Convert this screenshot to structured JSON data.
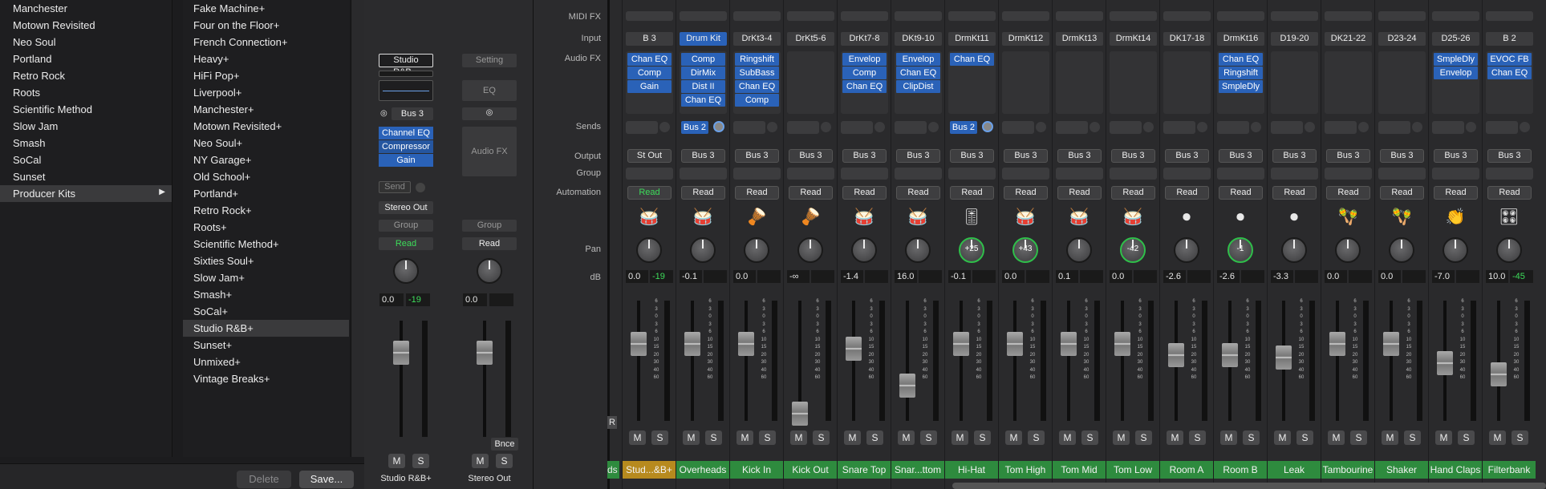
{
  "kits": [
    "Manchester",
    "Motown Revisited",
    "Neo Soul",
    "Portland",
    "Retro Rock",
    "Roots",
    "Scientific Method",
    "Slow Jam",
    "Smash",
    "SoCal",
    "Sunset",
    "Producer Kits"
  ],
  "patches": [
    "Fake Machine+",
    "Four on the Floor+",
    "French Connection+",
    "Heavy+",
    "HiFi Pop+",
    "Liverpool+",
    "Manchester+",
    "Motown Revisited+",
    "Neo Soul+",
    "NY Garage+",
    "Old School+",
    "Portland+",
    "Retro Rock+",
    "Roots+",
    "Scientific Method+",
    "Sixties Soul+",
    "Slow Jam+",
    "Smash+",
    "SoCal+",
    "Studio R&B+",
    "Sunset+",
    "Unmixed+",
    "Vintage Breaks+"
  ],
  "buttons": {
    "delete": "Delete",
    "save": "Save..."
  },
  "inspector": {
    "left": {
      "setting": "Studio R&B...",
      "input": "Bus 3",
      "plugins": [
        "Channel EQ",
        "Compressor",
        "Gain"
      ],
      "send": "Send",
      "output": "Stereo Out",
      "group": "Group",
      "automation": "Read",
      "db1": "0.0",
      "db2": "-19",
      "m": "M",
      "s": "S",
      "name": "Studio R&B+"
    },
    "right": {
      "setting": "Setting",
      "eq": "EQ",
      "audiofx": "Audio FX",
      "group": "Group",
      "automation": "Read",
      "db1": "0.0",
      "bnce": "Bnce",
      "m": "M",
      "s": "S",
      "name": "Stereo Out"
    }
  },
  "rowlabels": {
    "midifx": "MIDI FX",
    "input": "Input",
    "audiofx": "Audio FX",
    "sends": "Sends",
    "output": "Output",
    "group": "Group",
    "automation": "Automation",
    "pan": "Pan",
    "db": "dB"
  },
  "scale": [
    "6",
    "3",
    "0",
    "3",
    "6",
    "10",
    "15",
    "20",
    "30",
    "40",
    "60"
  ],
  "channels": [
    {
      "input": "B 3",
      "plugins": [
        "Chan EQ",
        "Comp",
        "Gain"
      ],
      "send": "",
      "output": "St Out",
      "auto": "Read",
      "pan": "",
      "db": "0.0",
      "peak": "-19",
      "name": "Stud...&B+",
      "icon": "🥁",
      "fader": 0.72,
      "color": "#b78a1e"
    },
    {
      "input": "Drum Kit",
      "plugins": [
        "Comp",
        "DirMix",
        "Dist II",
        "Chan EQ"
      ],
      "send": "Bus 2",
      "output": "Bus 3",
      "auto": "Read",
      "pan": "",
      "db": "-0.1",
      "peak": "",
      "name": "Overheads",
      "icon": "🥁",
      "fader": 0.72,
      "color": "#2e8b3e"
    },
    {
      "input": "DrKt3-4",
      "plugins": [
        "Ringshift",
        "SubBass",
        "Chan EQ",
        "Comp"
      ],
      "send": "",
      "output": "Bus 3",
      "auto": "Read",
      "pan": "",
      "db": "0.0",
      "peak": "",
      "name": "Kick In",
      "icon": "🪘",
      "fader": 0.72,
      "color": "#2e8b3e"
    },
    {
      "input": "DrKt5-6",
      "plugins": [],
      "send": "",
      "output": "Bus 3",
      "auto": "Read",
      "pan": "",
      "db": "-∞",
      "peak": "",
      "name": "Kick Out",
      "icon": "🪘",
      "fader": 0.1,
      "color": "#2e8b3e"
    },
    {
      "input": "DrKt7-8",
      "plugins": [
        "Envelop",
        "Comp",
        "Chan EQ"
      ],
      "send": "",
      "output": "Bus 3",
      "auto": "Read",
      "pan": "",
      "db": "-1.4",
      "peak": "",
      "name": "Snare Top",
      "icon": "🥁",
      "fader": 0.68,
      "color": "#2e8b3e"
    },
    {
      "input": "DKt9-10",
      "plugins": [
        "Envelop",
        "Chan EQ",
        "ClipDist"
      ],
      "send": "",
      "output": "Bus 3",
      "auto": "Read",
      "pan": "",
      "db": "16.0",
      "peak": "",
      "name": "Snar...ttom",
      "icon": "🥁",
      "fader": 0.35,
      "color": "#2e8b3e"
    },
    {
      "input": "DrmKt11",
      "plugins": [
        "Chan EQ"
      ],
      "send": "Bus 2",
      "output": "Bus 3",
      "auto": "Read",
      "pan": "+25",
      "db": "-0.1",
      "peak": "",
      "name": "Hi-Hat",
      "icon": "🎚",
      "fader": 0.72,
      "color": "#2e8b3e"
    },
    {
      "input": "DrmKt12",
      "plugins": [],
      "send": "",
      "output": "Bus 3",
      "auto": "Read",
      "pan": "+43",
      "db": "0.0",
      "peak": "",
      "name": "Tom High",
      "icon": "🥁",
      "fader": 0.72,
      "color": "#2e8b3e"
    },
    {
      "input": "DrmKt13",
      "plugins": [],
      "send": "",
      "output": "Bus 3",
      "auto": "Read",
      "pan": "",
      "db": "0.1",
      "peak": "",
      "name": "Tom Mid",
      "icon": "🥁",
      "fader": 0.72,
      "color": "#2e8b3e"
    },
    {
      "input": "DrmKt14",
      "plugins": [],
      "send": "",
      "output": "Bus 3",
      "auto": "Read",
      "pan": "-42",
      "db": "0.0",
      "peak": "",
      "name": "Tom Low",
      "icon": "🥁",
      "fader": 0.72,
      "color": "#2e8b3e"
    },
    {
      "input": "DK17-18",
      "plugins": [],
      "send": "",
      "output": "Bus 3",
      "auto": "Read",
      "pan": "",
      "db": "-2.6",
      "peak": "",
      "name": "Room A",
      "icon": "⏺",
      "fader": 0.62,
      "color": "#2e8b3e"
    },
    {
      "input": "DrmKt16",
      "plugins": [
        "Chan EQ",
        "Ringshift",
        "SmpleDly"
      ],
      "send": "",
      "output": "Bus 3",
      "auto": "Read",
      "pan": "-1",
      "db": "-2.6",
      "peak": "",
      "name": "Room B",
      "icon": "⏺",
      "fader": 0.62,
      "color": "#2e8b3e"
    },
    {
      "input": "D19-20",
      "plugins": [],
      "send": "",
      "output": "Bus 3",
      "auto": "Read",
      "pan": "",
      "db": "-3.3",
      "peak": "",
      "name": "Leak",
      "icon": "⏺",
      "fader": 0.6,
      "color": "#2e8b3e"
    },
    {
      "input": "DK21-22",
      "plugins": [],
      "send": "",
      "output": "Bus 3",
      "auto": "Read",
      "pan": "",
      "db": "0.0",
      "peak": "",
      "name": "Tambourine",
      "icon": "🪇",
      "fader": 0.72,
      "color": "#2e8b3e"
    },
    {
      "input": "D23-24",
      "plugins": [],
      "send": "",
      "output": "Bus 3",
      "auto": "Read",
      "pan": "",
      "db": "0.0",
      "peak": "",
      "name": "Shaker",
      "icon": "🪇",
      "fader": 0.72,
      "color": "#2e8b3e"
    },
    {
      "input": "D25-26",
      "plugins": [
        "SmpleDly",
        "Envelop"
      ],
      "send": "",
      "output": "Bus 3",
      "auto": "Read",
      "pan": "",
      "db": "-7.0",
      "peak": "",
      "name": "Hand Claps",
      "icon": "👏",
      "fader": 0.55,
      "color": "#2e8b3e"
    },
    {
      "input": "B 2",
      "plugins": [
        "EVOC FB",
        "Chan EQ"
      ],
      "send": "",
      "output": "Bus 3",
      "auto": "Read",
      "pan": "",
      "db": "10.0",
      "peak": "-45",
      "name": "Filterbank",
      "icon": "🎛",
      "fader": 0.45,
      "color": "#2e8b3e"
    }
  ],
  "partial_channel": {
    "name": "ds",
    "r": "R"
  }
}
